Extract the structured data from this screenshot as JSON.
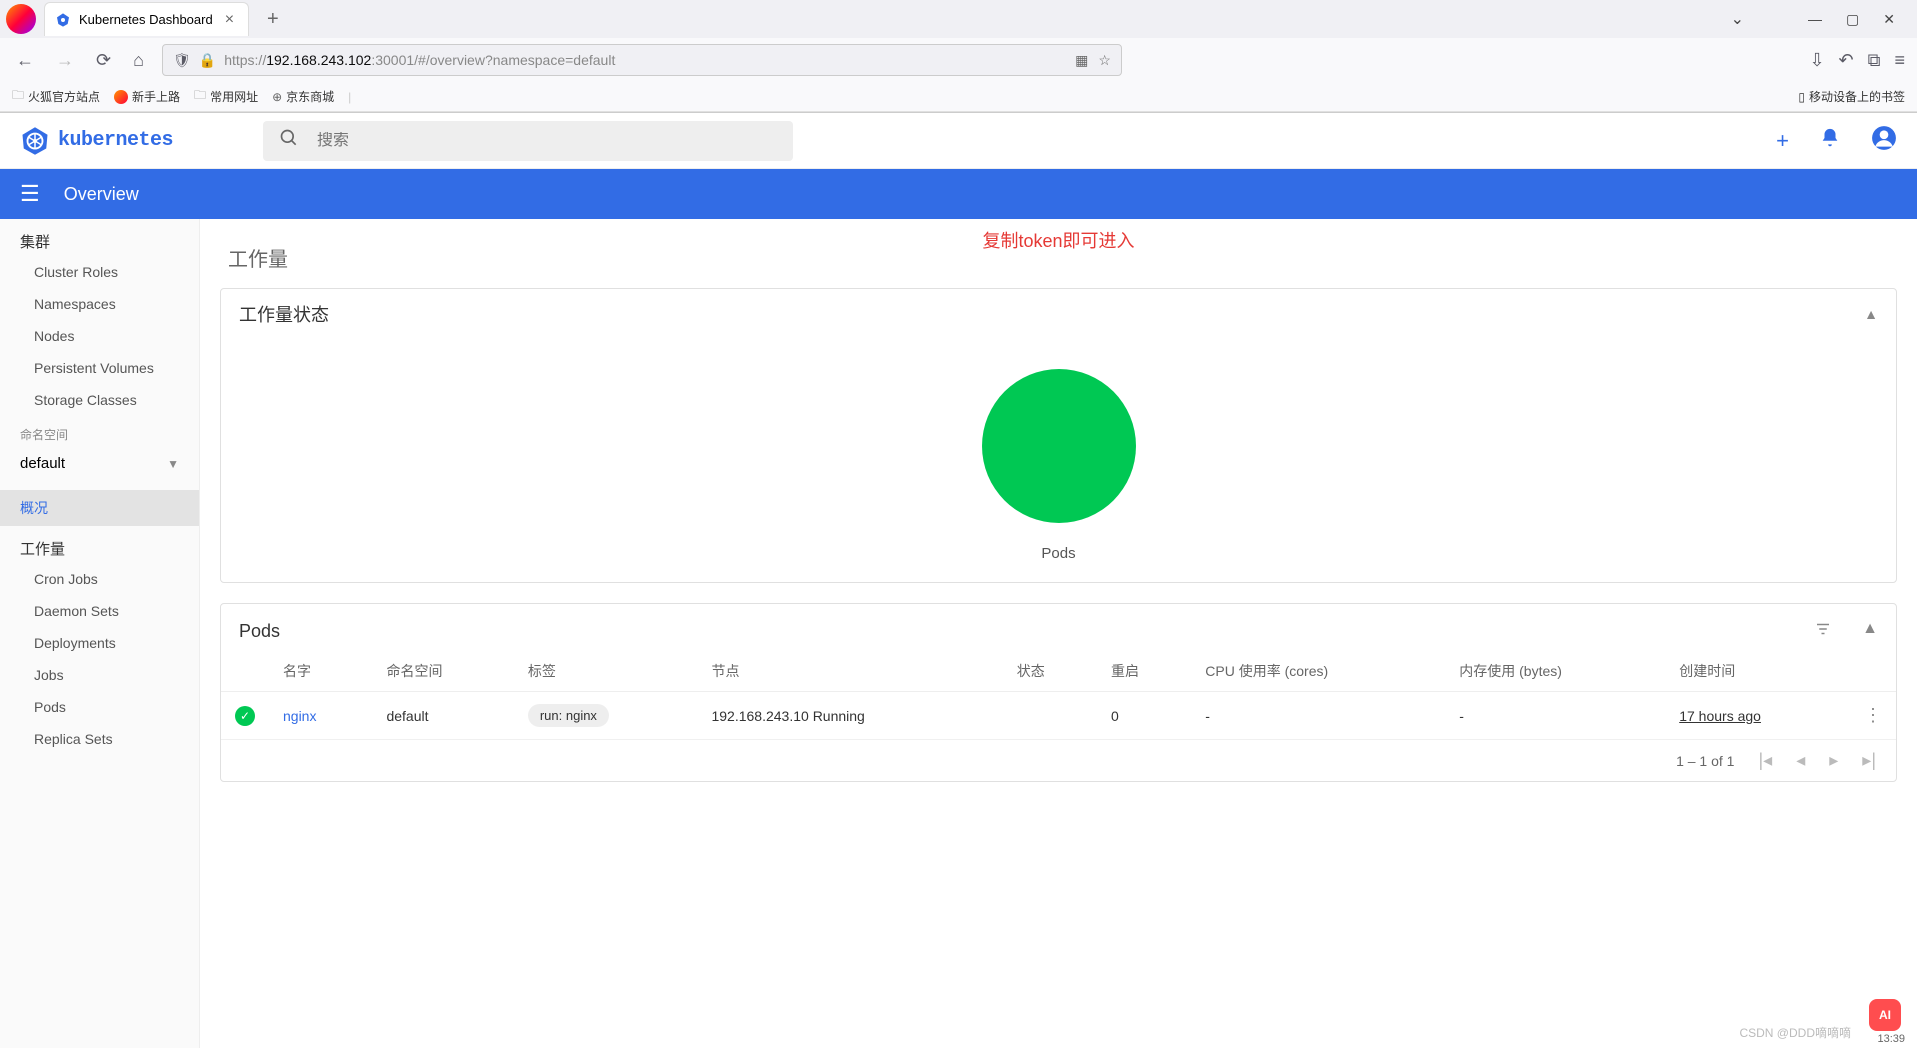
{
  "browser": {
    "tab_title": "Kubernetes Dashboard",
    "url_prefix": "https://",
    "url_host": "192.168.243.102",
    "url_port_path": ":30001/#/overview?namespace=default",
    "bookmarks": {
      "b1": "火狐官方站点",
      "b2": "新手上路",
      "b3": "常用网址",
      "b4": "京东商城",
      "right": "移动设备上的书签"
    }
  },
  "header": {
    "brand": "kubernetes",
    "search_placeholder": "搜索"
  },
  "bluebar": {
    "title": "Overview"
  },
  "annotation": "复制token即可进入",
  "sidebar": {
    "cluster_section": "集群",
    "cluster": {
      "c0": "Cluster Roles",
      "c1": "Namespaces",
      "c2": "Nodes",
      "c3": "Persistent Volumes",
      "c4": "Storage Classes"
    },
    "ns_label": "命名空间",
    "ns_value": "default",
    "overview": "概况",
    "workload_section": "工作量",
    "workload": {
      "w0": "Cron Jobs",
      "w1": "Daemon Sets",
      "w2": "Deployments",
      "w3": "Jobs",
      "w4": "Pods",
      "w5": "Replica Sets"
    }
  },
  "main": {
    "section_title": "工作量",
    "status_card_title": "工作量状态",
    "chart_label": "Pods",
    "pods_card_title": "Pods",
    "columns": {
      "name": "名字",
      "namespace": "命名空间",
      "labels": "标签",
      "node": "节点",
      "status": "状态",
      "restarts": "重启",
      "cpu": "CPU 使用率 (cores)",
      "memory": "内存使用 (bytes)",
      "created": "创建时间"
    },
    "row": {
      "name": "nginx",
      "namespace": "default",
      "label": "run: nginx",
      "node": "192.168.243.10",
      "status": "Running",
      "restarts": "0",
      "cpu": "-",
      "memory": "-",
      "created": "17 hours ago"
    },
    "pagination": "1 – 1 of 1"
  },
  "chart_data": {
    "type": "pie",
    "title": "Pods",
    "series": [
      {
        "name": "Running",
        "value": 1,
        "color": "#00c853"
      }
    ],
    "total": 1
  },
  "footer": {
    "watermark": "CSDN @DDD嘀嘀嘀",
    "time": "13:39"
  }
}
